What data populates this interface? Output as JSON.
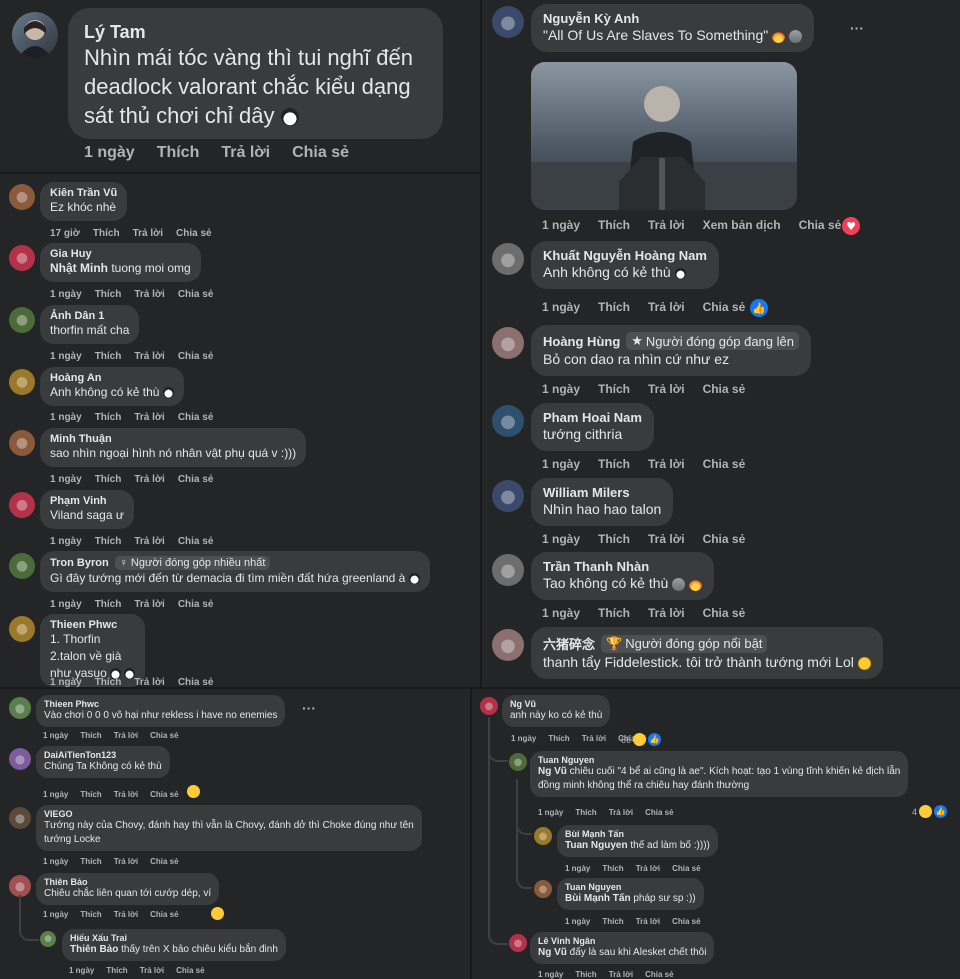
{
  "actions": {
    "like": "Thích",
    "reply": "Trả lời",
    "share": "Chia sẻ",
    "translate": "Xem bản dịch"
  },
  "panel_a": {
    "name": "Lý Tam",
    "text_lines": [
      "Nhìn mái tóc vàng thì tui nghĩ đến",
      "deadlock valorant chắc kiểu dạng",
      "sát thủ chơi chỉ dây"
    ],
    "time": "1 ngày"
  },
  "panel_b": {
    "comments": [
      {
        "name": "Kiên Trần Vũ",
        "lines": [
          "Ez khóc nhè"
        ],
        "time": "17 giờ"
      },
      {
        "name": "Gia Huy",
        "mention": "Nhật Minh",
        "lines": [
          "tuong moi omg"
        ],
        "time": "1 ngày"
      },
      {
        "name": "Ảnh Dân 1",
        "lines": [
          "thorfin mất cha"
        ],
        "time": "1 ngày"
      },
      {
        "name": "Hoàng An",
        "lines": [
          "Anh không có kẻ thù"
        ],
        "time": "1 ngày"
      },
      {
        "name": "Minh Thuận",
        "lines": [
          "sao nhìn ngoại hình nó nhân vật phụ quá v :)))"
        ],
        "time": "1 ngày"
      },
      {
        "name": "Phạm Vinh",
        "lines": [
          "Viland saga ư"
        ],
        "time": "1 ngày"
      },
      {
        "name": "Tron Byron",
        "badge": "Người đóng góp nhiều nhất",
        "lines": [
          "Gì đây tướng mới đến từ demacia đi tìm miền đất hứa greenland à"
        ],
        "time": "1 ngày"
      },
      {
        "name": "Thieen Phwc",
        "lines": [
          "1. Thorfin",
          "2.talon về già",
          "như yasuo"
        ],
        "time": "1 ngày"
      }
    ]
  },
  "panel_c": {
    "comments": [
      {
        "name": "Nguyễn Kỳ Anh",
        "lines": [
          "\"All Of Us Are Slaves To Something\""
        ],
        "time": "1 ngày",
        "more": "···"
      },
      {
        "name": "Khuất Nguyễn Hoàng Nam",
        "lines": [
          "Anh không có kẻ thù"
        ],
        "time": "1 ngày"
      },
      {
        "name": "Hoàng Hùng",
        "badge": "Người đóng góp đang lên",
        "lines": [
          "Bỏ con dao ra nhìn cứ như ez"
        ],
        "time": "1 ngày"
      },
      {
        "name": "Pham Hoai Nam",
        "lines": [
          "tướng cithria"
        ],
        "time": "1 ngày"
      },
      {
        "name": "William Milers",
        "lines": [
          "Nhìn hao hao talon"
        ],
        "time": "1 ngày"
      },
      {
        "name": "Trần Thanh Nhàn",
        "lines": [
          "Tao không có kẻ thù"
        ],
        "time": "1 ngày"
      },
      {
        "name": "六猪碎念",
        "badge": "Người đóng góp nổi bật",
        "lines": [
          "thanh tẩy Fiddelestick. tôi trở thành tướng mới Lol"
        ],
        "time": ""
      }
    ]
  },
  "panel_d": {
    "comments": [
      {
        "name": "Thieen Phwc",
        "lines": [
          "Vào chơi 0 0 0 vô hại như rekless i have no enemies"
        ],
        "time": "1 ngày",
        "more": "···"
      },
      {
        "name": "DaiAiTienTon123",
        "lines": [
          "Chúng Ta Không có kẻ thù"
        ],
        "time": "1 ngày"
      },
      {
        "name": "VIEGO",
        "lines": [
          "Tướng này của Chovy, đánh hay thì vẫn là Chovy, đánh dở thì Choke đúng như tên",
          "tướng Locke"
        ],
        "time": "1 ngày"
      },
      {
        "name": "Thiên Bảo",
        "lines": [
          "Chiêu chắc liên quan tới cướp dép, ví"
        ],
        "time": "1 ngày"
      },
      {
        "name": "Hiếu Xấu Trai",
        "mention": "Thiên Bảo",
        "lines": [
          "thấy trên X bảo chiêu kiểu bắn đinh"
        ],
        "time": "1 ngày"
      }
    ]
  },
  "panel_e": {
    "comments": [
      {
        "name": "Ng Vũ",
        "lines": [
          "anh này ko có kẻ thù"
        ],
        "time": "1 ngày",
        "reactions": "66"
      },
      {
        "name": "Tuan Nguyen",
        "mention": "Ng Vũ",
        "lines": [
          "chiêu cuối \"4 bể ai cũng là ae\". Kích hoạt: tạo 1 vùng tĩnh khiến kẻ địch lẫn",
          "đồng minh không thể ra chiêu hay đánh thường"
        ],
        "time": "1 ngày",
        "reactions": "4"
      },
      {
        "name": "Bùi Mạnh Tấn",
        "mention": "Tuan Nguyen",
        "lines": [
          "thế ad làm bố :))))"
        ],
        "time": "1 ngày"
      },
      {
        "name": "Tuan Nguyen",
        "mention": "Bùi Mạnh Tấn",
        "lines": [
          "pháp sư sp :))"
        ],
        "time": "1 ngày"
      },
      {
        "name": "Lê Vinh Ngân",
        "mention": "Ng Vũ",
        "lines": [
          "đấy là sau khi Alesket chết thôi"
        ],
        "time": "1 ngày"
      }
    ]
  },
  "colors": {
    "bg": "#242526",
    "bubble": "#3a3b3c",
    "text": "#e4e6eb",
    "muted": "#b0b3b8",
    "like_blue": "#1877f2",
    "love_red": "#f33e58"
  }
}
